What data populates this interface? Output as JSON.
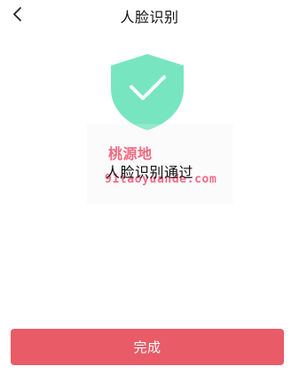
{
  "header": {
    "title": "人脸识别",
    "back_icon": "chevron-left-icon"
  },
  "result": {
    "icon": "shield-check-icon",
    "status_text": "人脸识别通过",
    "shield_color": "#77e6c0"
  },
  "watermark": {
    "chinese": "桃源地",
    "url": "91taoyuande.com",
    "color": "#f06a82"
  },
  "actions": {
    "done_label": "完成",
    "button_color": "#e85b67"
  }
}
